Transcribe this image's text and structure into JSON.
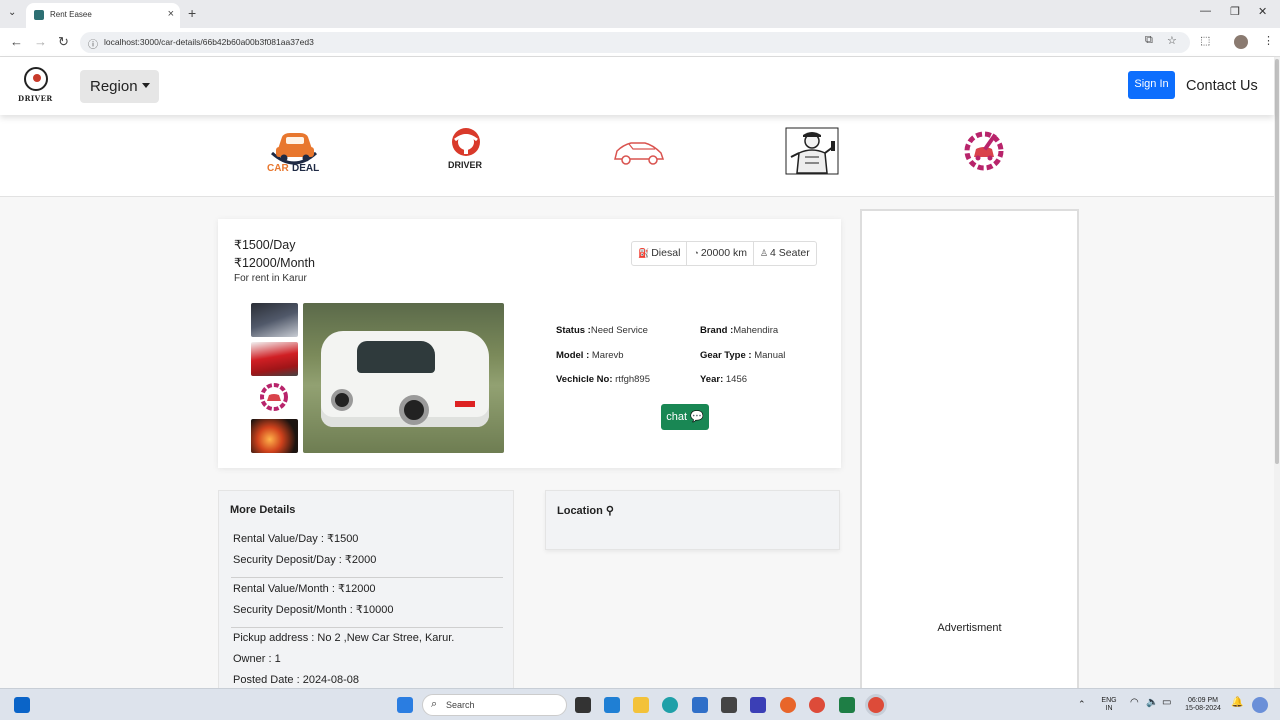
{
  "browser": {
    "tab_title": "Rent Easee",
    "url": "localhost:3000/car-details/66b42b60a00b3f081aa37ed3"
  },
  "header": {
    "logo_text": "DRIVER",
    "region_label": "Region",
    "signin_label": "Sign In",
    "contact_label": "Contact Us"
  },
  "categories": [
    {
      "icon": "car-deal-icon",
      "label_a": "CAR",
      "label_b": "DEAL"
    },
    {
      "icon": "driver-icon",
      "label": "DRIVER"
    },
    {
      "icon": "car-outline-icon"
    },
    {
      "icon": "mechanic-icon"
    },
    {
      "icon": "car-service-gear-icon"
    }
  ],
  "listing": {
    "price_day": "₹1500/Day",
    "price_month": "₹12000/Month",
    "rent_location": "For rent in Karur",
    "specs": {
      "fuel": "Diesal",
      "km": "20000 km",
      "seats": "4 Seater"
    },
    "details": {
      "status_label": "Status :",
      "status": "Need Service",
      "brand_label": "Brand :",
      "brand": "Mahendira",
      "model_label": "Model :",
      "model": "Marevb",
      "gear_label": "Gear Type :",
      "gear": "Manual",
      "vehicle_no_label": "Vechicle No:",
      "vehicle_no": "rtfgh895",
      "year_label": "Year:",
      "year": "1456"
    },
    "chat_label": "chat"
  },
  "more_details": {
    "title": "More Details",
    "rental_day": "Rental Value/Day : ₹1500",
    "deposit_day": "Security Deposit/Day : ₹2000",
    "rental_month": "Rental Value/Month : ₹12000",
    "deposit_month": "Security Deposit/Month : ₹10000",
    "pickup": "Pickup address : No 2 ,New Car Stree, Karur.",
    "owner": "Owner : 1",
    "posted": "Posted Date : 2024-08-08"
  },
  "location": {
    "title": "Location"
  },
  "ad": {
    "label": "Advertisment"
  },
  "taskbar": {
    "search_placeholder": "Search",
    "lang_top": "ENG",
    "lang_bottom": "IN",
    "time": "06:09 PM",
    "date": "15-08-2024"
  },
  "colors": {
    "primary": "#0d6efd",
    "success": "#198754",
    "brand_red": "#c73a2a",
    "brand_magenta": "#b8246b"
  }
}
